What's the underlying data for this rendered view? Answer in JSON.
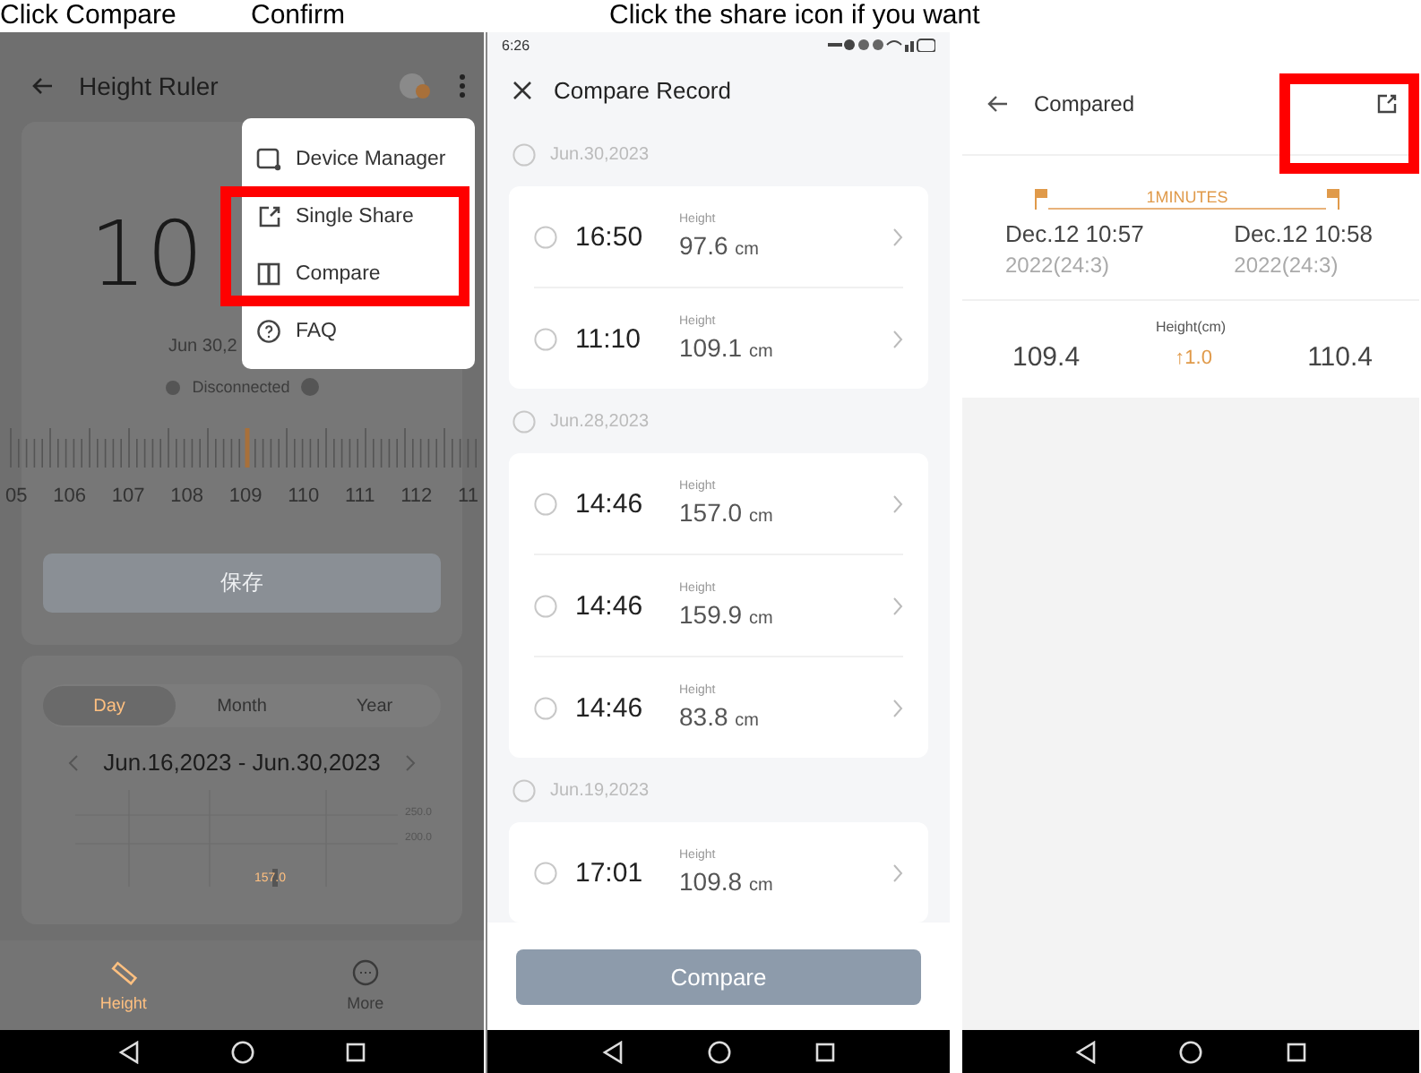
{
  "captions": [
    "Click Compare",
    "Confirm",
    "Click the share icon if you want"
  ],
  "home": {
    "title": "Height Ruler",
    "reading": "10",
    "date": "Jun 30,2",
    "status": "Disconnected",
    "ruler_labels": [
      "05",
      "106",
      "107",
      "108",
      "109",
      "110",
      "111",
      "112",
      "11"
    ],
    "save_button": "保存",
    "period_tabs": [
      {
        "label": "Day",
        "selected": true
      },
      {
        "label": "Month",
        "selected": false
      },
      {
        "label": "Year",
        "selected": false
      }
    ],
    "date_range": "Jun.16,2023 - Jun.30,2023",
    "chart_axis_labels": [
      "250.0",
      "200.0"
    ],
    "chart_bar_label": "157.0",
    "menu": [
      {
        "label": "Device Manager"
      },
      {
        "label": "Single Share"
      },
      {
        "label": "Compare"
      },
      {
        "label": "FAQ"
      }
    ],
    "bottom_nav": [
      {
        "label": "Height",
        "selected": true
      },
      {
        "label": "More",
        "selected": false
      }
    ]
  },
  "compare_record": {
    "time": "6:26",
    "title": "Compare Record",
    "groups": [
      {
        "date": "Jun.30,2023",
        "selected": false,
        "records": [
          {
            "time": "16:50",
            "label": "Height",
            "value": "97.6",
            "unit": "cm",
            "selected": false
          },
          {
            "time": "11:10",
            "label": "Height",
            "value": "109.1",
            "unit": "cm",
            "selected": false
          }
        ]
      },
      {
        "date": "Jun.28,2023",
        "selected": false,
        "records": [
          {
            "time": "14:46",
            "label": "Height",
            "value": "157.0",
            "unit": "cm",
            "selected": false
          },
          {
            "time": "14:46",
            "label": "Height",
            "value": "159.9",
            "unit": "cm",
            "selected": false
          },
          {
            "time": "14:46",
            "label": "Height",
            "value": "83.8",
            "unit": "cm",
            "selected": false
          }
        ]
      },
      {
        "date": "Jun.19,2023",
        "selected": false,
        "records": [
          {
            "time": "17:01",
            "label": "Height",
            "value": "109.8",
            "unit": "cm",
            "selected": false
          }
        ]
      }
    ],
    "compare_button": {
      "label": "Compare",
      "disabled": true
    }
  },
  "compared": {
    "title": "Compared",
    "interval": "1MINUTES",
    "left": {
      "date": "Dec.12 10:57",
      "year": "2022(24:3)"
    },
    "right": {
      "date": "Dec.12 10:58",
      "year": "2022(24:3)"
    },
    "metric": "Height(cm)",
    "left_value": "109.4",
    "difference": "↑1.0",
    "right_value": "110.4"
  }
}
